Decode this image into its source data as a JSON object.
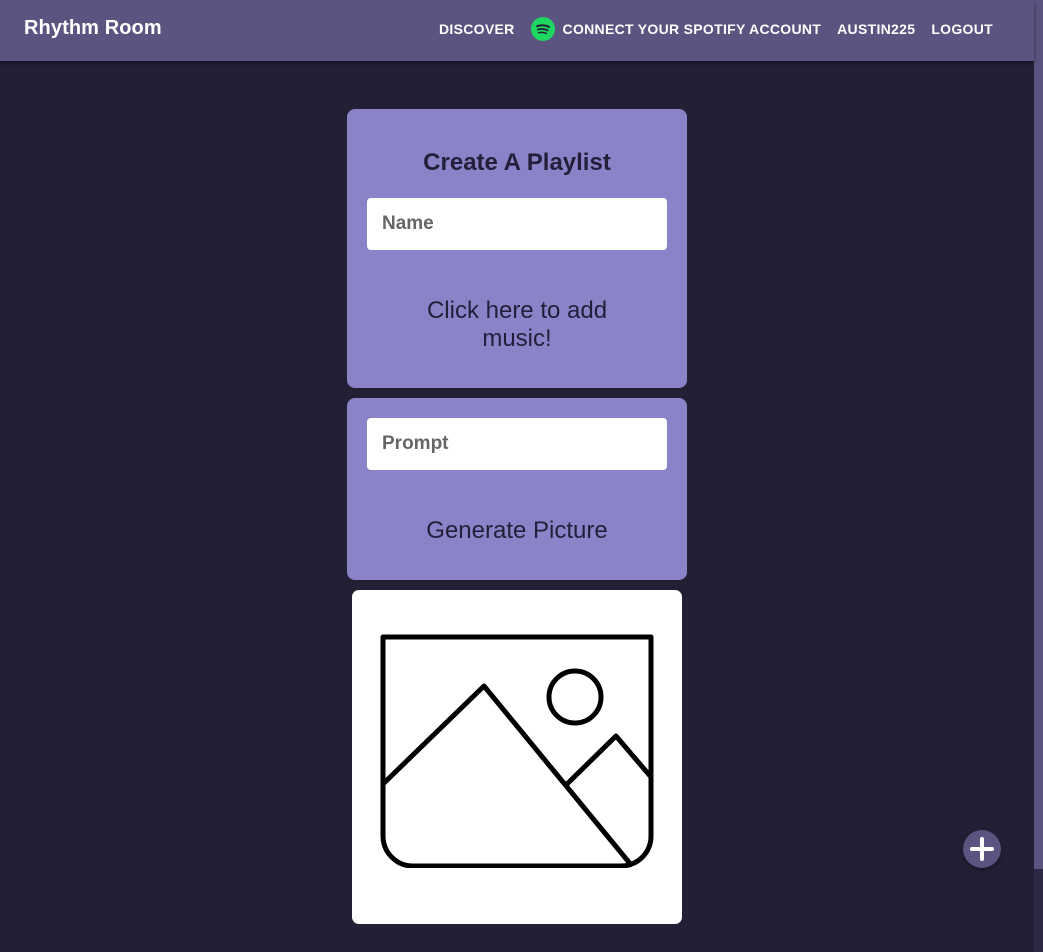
{
  "header": {
    "brand": "Rhythm Room",
    "nav": {
      "discover": "DISCOVER",
      "connect_spotify": "CONNECT YOUR SPOTIFY ACCOUNT",
      "username": "AUSTIN225",
      "logout": "LOGOUT"
    }
  },
  "playlist_form": {
    "title": "Create A Playlist",
    "name_placeholder": "Name",
    "name_value": "",
    "add_music_label": "Click here to add music!"
  },
  "picture_form": {
    "prompt_placeholder": "Prompt",
    "prompt_value": "",
    "generate_label": "Generate Picture"
  },
  "image_preview": {
    "icon": "image-placeholder-icon"
  },
  "fab": {
    "icon": "plus-icon"
  },
  "colors": {
    "appbar": "#5b5480",
    "background": "#232036",
    "card": "#8b83c7",
    "spotify_green": "#1ed760",
    "text_dark": "#231f3a"
  }
}
